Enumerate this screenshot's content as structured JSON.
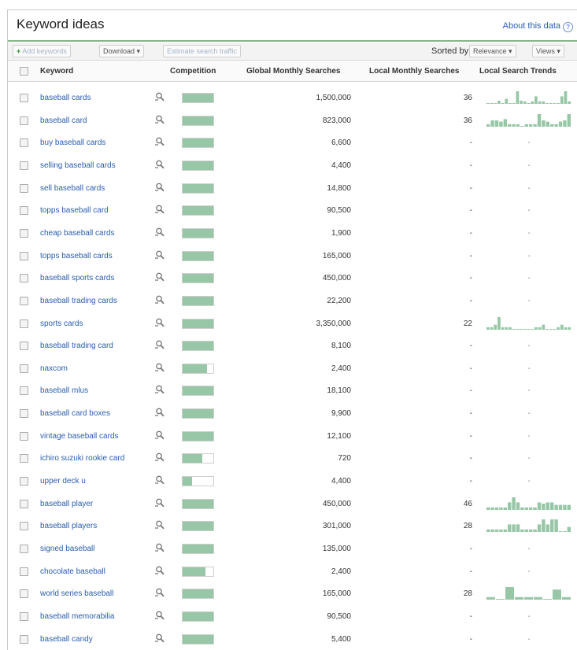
{
  "panel": {
    "title": "Keyword ideas",
    "about_link": "About this data",
    "help_symbol": "?"
  },
  "toolbar": {
    "add_keywords": "Add keywords",
    "download": "Download",
    "estimate": "Estimate search traffic",
    "sorted_by": "Sorted by",
    "sort_value": "Relevance",
    "views": "Views"
  },
  "columns": {
    "keyword": "Keyword",
    "competition": "Competition",
    "global": "Global Monthly Searches",
    "local": "Local Monthly Searches",
    "trends": "Local Search Trends"
  },
  "colors": {
    "link": "#2a5db0",
    "competition_fill": "#97c7a6",
    "trend_bar": "#97c7a6",
    "header_rule": "#86b487"
  },
  "icons": {
    "row_tool": "magnifier-icon",
    "add": "plus-icon",
    "dropdown": "chevron-down-icon"
  },
  "rows": [
    {
      "keyword": "baseball cards",
      "competition": 1.0,
      "global": "1,500,000",
      "local": "36",
      "trend": [
        0,
        0,
        0,
        0.25,
        0,
        0.4,
        0,
        0,
        1,
        0.25,
        0.2,
        0,
        0.2,
        0.6,
        0.2,
        0.2,
        0,
        0,
        0,
        0,
        0.6,
        1,
        0.2
      ]
    },
    {
      "keyword": "baseball card",
      "competition": 1.0,
      "global": "823,000",
      "local": "36",
      "trend": [
        0.2,
        0.5,
        0.5,
        0.4,
        0.6,
        0.2,
        0.2,
        0.2,
        0,
        0.2,
        0.2,
        0.2,
        1,
        0.5,
        0.4,
        0.2,
        0.2,
        0.4,
        0.5,
        1
      ]
    },
    {
      "keyword": "buy baseball cards",
      "competition": 1.0,
      "global": "6,600",
      "local": "-",
      "trend": null
    },
    {
      "keyword": "selling baseball cards",
      "competition": 1.0,
      "global": "4,400",
      "local": "-",
      "trend": null
    },
    {
      "keyword": "sell baseball cards",
      "competition": 1.0,
      "global": "14,800",
      "local": "-",
      "trend": null
    },
    {
      "keyword": "topps baseball card",
      "competition": 1.0,
      "global": "90,500",
      "local": "-",
      "trend": null
    },
    {
      "keyword": "cheap baseball cards",
      "competition": 1.0,
      "global": "1,900",
      "local": "-",
      "trend": null
    },
    {
      "keyword": "topps baseball cards",
      "competition": 1.0,
      "global": "165,000",
      "local": "-",
      "trend": null
    },
    {
      "keyword": "baseball sports cards",
      "competition": 1.0,
      "global": "450,000",
      "local": "-",
      "trend": null
    },
    {
      "keyword": "baseball trading cards",
      "competition": 1.0,
      "global": "22,200",
      "local": "-",
      "trend": null
    },
    {
      "keyword": "sports cards",
      "competition": 1.0,
      "global": "3,350,000",
      "local": "22",
      "trend": [
        0.2,
        0.2,
        0.4,
        1,
        0.2,
        0.2,
        0.2,
        0,
        0,
        0,
        0,
        0,
        0,
        0.2,
        0.2,
        0.4,
        0,
        0,
        0,
        0.2,
        0.4,
        0.2,
        0.2
      ]
    },
    {
      "keyword": "baseball trading card",
      "competition": 1.0,
      "global": "8,100",
      "local": "-",
      "trend": null
    },
    {
      "keyword": "naxcom",
      "competition": 0.8,
      "global": "2,400",
      "local": "-",
      "trend": null
    },
    {
      "keyword": "baseball mlus",
      "competition": 1.0,
      "global": "18,100",
      "local": "-",
      "trend": null
    },
    {
      "keyword": "baseball card boxes",
      "competition": 1.0,
      "global": "9,900",
      "local": "-",
      "trend": null
    },
    {
      "keyword": "vintage baseball cards",
      "competition": 1.0,
      "global": "12,100",
      "local": "-",
      "trend": null
    },
    {
      "keyword": "ichiro suzuki rookie card",
      "competition": 0.65,
      "global": "720",
      "local": "-",
      "trend": null
    },
    {
      "keyword": "upper deck u",
      "competition": 0.3,
      "global": "4,400",
      "local": "-",
      "trend": null
    },
    {
      "keyword": "baseball player",
      "competition": 1.0,
      "global": "450,000",
      "local": "46",
      "trend": [
        0.2,
        0.2,
        0.2,
        0.2,
        0.2,
        0.6,
        1,
        0.6,
        0.2,
        0.2,
        0.2,
        0.2,
        0.6,
        0.5,
        0.6,
        0.6,
        0.4,
        0.4,
        0.4,
        0.4
      ]
    },
    {
      "keyword": "baseball players",
      "competition": 1.0,
      "global": "301,000",
      "local": "28",
      "trend": [
        0.2,
        0.2,
        0.2,
        0.2,
        0.2,
        0.6,
        0.6,
        0.6,
        0.2,
        0.2,
        0.2,
        0.2,
        0.6,
        1,
        0.6,
        1,
        1,
        0,
        0,
        0.4
      ]
    },
    {
      "keyword": "signed baseball",
      "competition": 1.0,
      "global": "135,000",
      "local": "-",
      "trend": null
    },
    {
      "keyword": "chocolate baseball",
      "competition": 0.75,
      "global": "2,400",
      "local": "-",
      "trend": null
    },
    {
      "keyword": "world series baseball",
      "competition": 1.0,
      "global": "165,000",
      "local": "28",
      "trend": [
        0.2,
        0,
        1,
        0.2,
        0.2,
        0.2,
        0,
        0.8,
        0.2
      ]
    },
    {
      "keyword": "baseball memorabilia",
      "competition": 1.0,
      "global": "90,500",
      "local": "-",
      "trend": null
    },
    {
      "keyword": "baseball candy",
      "competition": 1.0,
      "global": "5,400",
      "local": "-",
      "trend": null
    }
  ]
}
